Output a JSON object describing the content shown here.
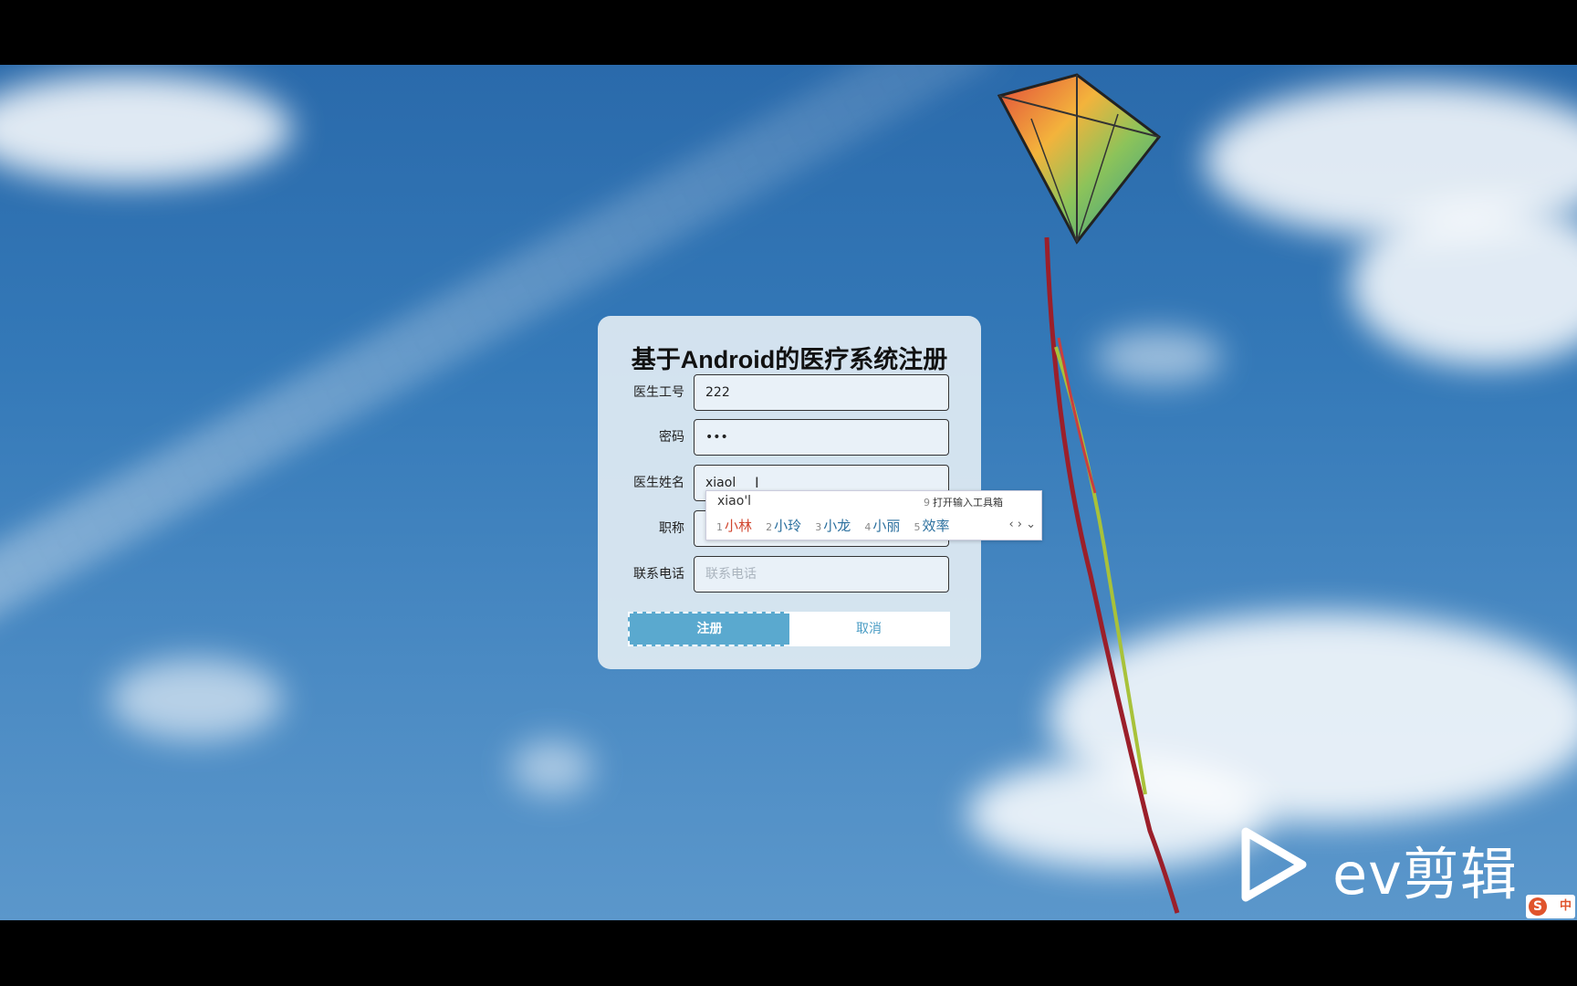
{
  "form": {
    "title": "基于Android的医疗系统注册",
    "fields": [
      {
        "label": "医生工号",
        "value": "222",
        "placeholder": ""
      },
      {
        "label": "密码",
        "value": "•••",
        "placeholder": ""
      },
      {
        "label": "医生姓名",
        "value": "xiaol",
        "placeholder": ""
      },
      {
        "label": "职称",
        "value": "",
        "placeholder": ""
      },
      {
        "label": "联系电话",
        "value": "",
        "placeholder": "联系电话"
      }
    ],
    "register_label": "注册",
    "cancel_label": "取消"
  },
  "ime": {
    "composition": "xiao'l",
    "tool_number": "9",
    "tool_label": "打开输入工具箱",
    "candidates": [
      {
        "num": "1",
        "word": "小林"
      },
      {
        "num": "2",
        "word": "小玲"
      },
      {
        "num": "3",
        "word": "小龙"
      },
      {
        "num": "4",
        "word": "小丽"
      },
      {
        "num": "5",
        "word": "效率"
      }
    ],
    "nav": "‹ › ⌄"
  },
  "watermark": {
    "text": "ev剪辑"
  },
  "ime_status": {
    "label": "中",
    "logo": "S"
  }
}
